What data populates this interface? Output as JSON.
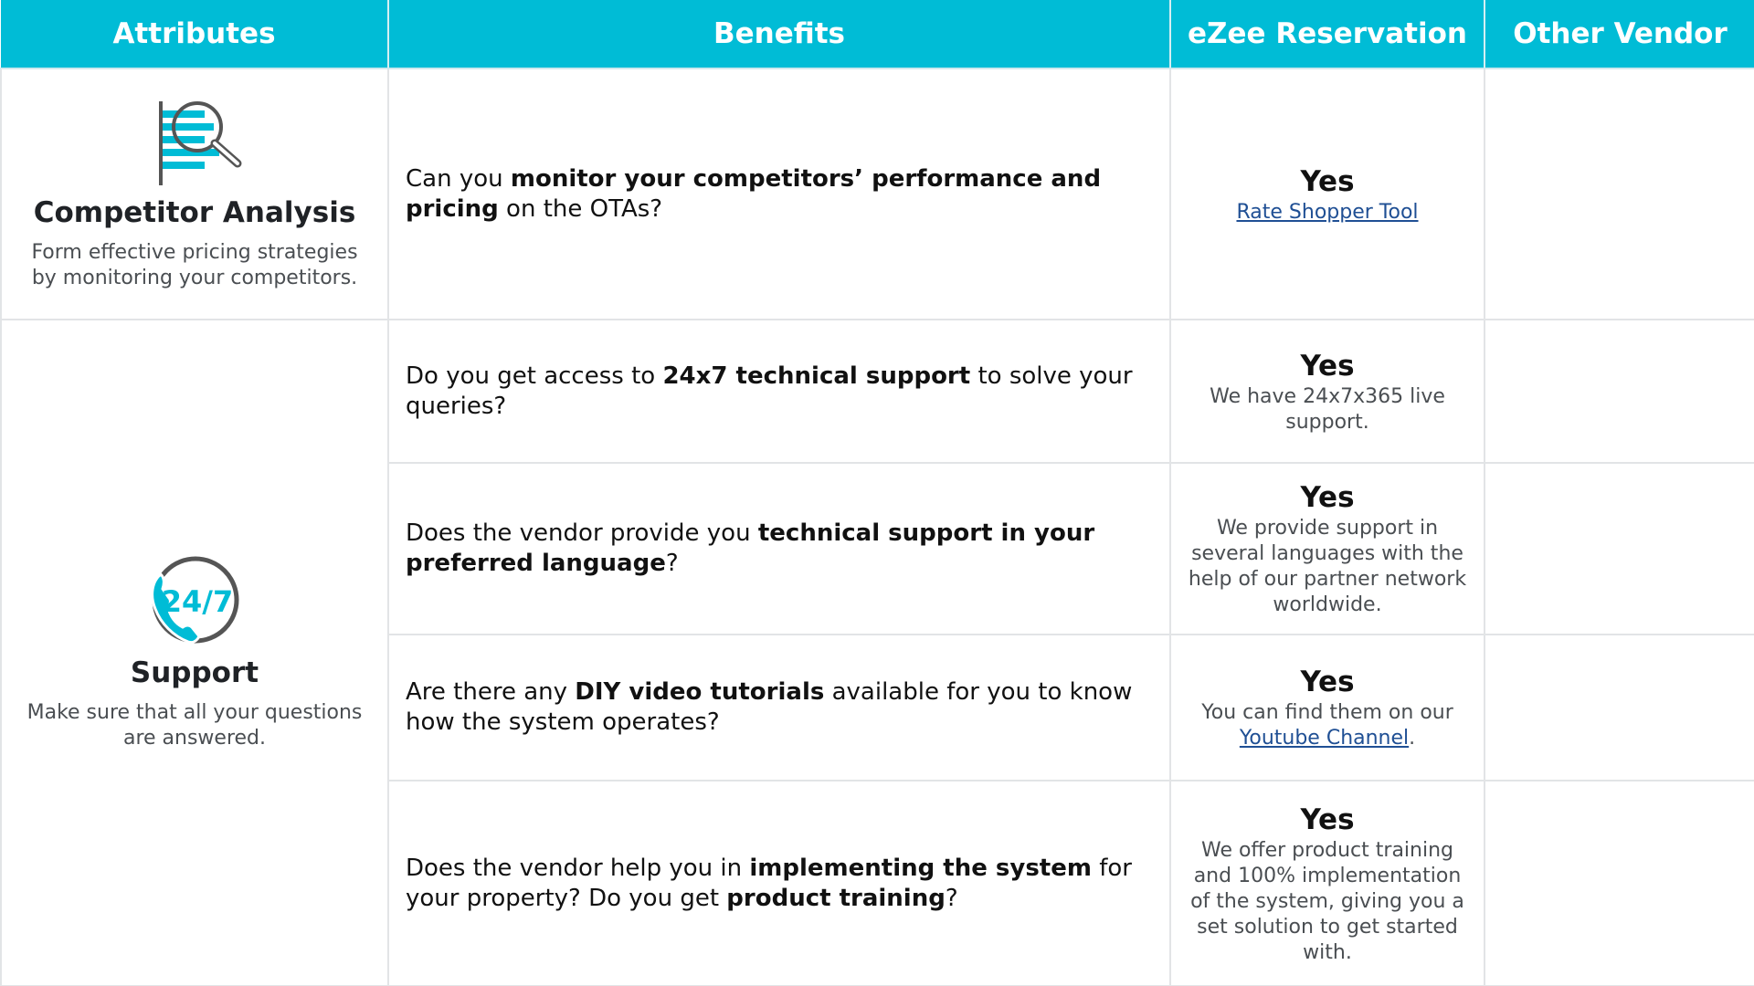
{
  "header": {
    "attributes": "Attributes",
    "benefits": "Benefits",
    "ezee": "eZee Reservation",
    "other": "Other Vendor"
  },
  "icons": {
    "competitor": "magnifier-bars-icon",
    "support": "phone-24-7-icon",
    "support_icon_text": "24/7",
    "accent": "#00bcd6",
    "dark": "#555555"
  },
  "groups": [
    {
      "title": "Competitor Analysis",
      "desc": "Form effective pricing strategies by monitoring your competitors.",
      "rows": [
        {
          "q_pre": "Can you ",
          "q_bold": "monitor your competitors’ performance and pricing",
          "q_post": " on the OTAs?",
          "yes": "Yes",
          "link": "Rate Shopper Tool"
        }
      ]
    },
    {
      "title": "Support",
      "desc": "Make sure that all your questions are answered.",
      "rows": [
        {
          "q_pre": "Do you get access to ",
          "q_bold": "24x7 technical support",
          "q_post": " to solve your queries?",
          "yes": "Yes",
          "note": "We have 24x7x365 live support."
        },
        {
          "q_pre": "Does the vendor provide you ",
          "q_bold": "technical support in your preferred language",
          "q_post": "?",
          "yes": "Yes",
          "note": "We provide support in several languages with the help of our partner network worldwide."
        },
        {
          "q_pre": "Are there any ",
          "q_bold": "DIY video tutorials",
          "q_post": " available for you to know how the system operates?",
          "yes": "Yes",
          "note_pre": "You can find them on our",
          "link": "Youtube Channel",
          "note_post": "."
        },
        {
          "q_pre": "Does the vendor help you in ",
          "q_bold": "implementing the system",
          "q_mid": " for your property? Do you get ",
          "q_bold2": "product training",
          "q_post": "?",
          "yes": "Yes",
          "note": "We offer product training and 100% implementation of the system, giving you a set solution to get started with."
        }
      ]
    }
  ]
}
